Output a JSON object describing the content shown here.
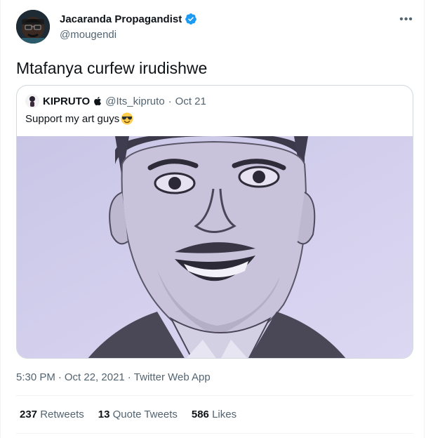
{
  "author": {
    "name": "Jacaranda Propagandist",
    "handle": "@mougendi",
    "verified_icon": "verified-badge-icon",
    "accent": "#1d9bf0"
  },
  "more_icon_glyph": "•••",
  "tweet_text": "Mtafanya curfew irudishwe",
  "quoted": {
    "name": "KIPRUTO",
    "handle": "@Its_kipruto",
    "dot": "·",
    "date": "Oct 21",
    "text": "Support my art guys",
    "emoji": "smiling-face-with-sunglasses-icon",
    "image": "pencil-portrait-drawing"
  },
  "meta": {
    "time": "5:30 PM",
    "dot1": "·",
    "date": "Oct 22, 2021",
    "dot2": "·",
    "source": "Twitter Web App"
  },
  "stats": {
    "retweets_count": "237",
    "retweets_label": "Retweets",
    "quotes_count": "13",
    "quotes_label": "Quote Tweets",
    "likes_count": "586",
    "likes_label": "Likes"
  }
}
